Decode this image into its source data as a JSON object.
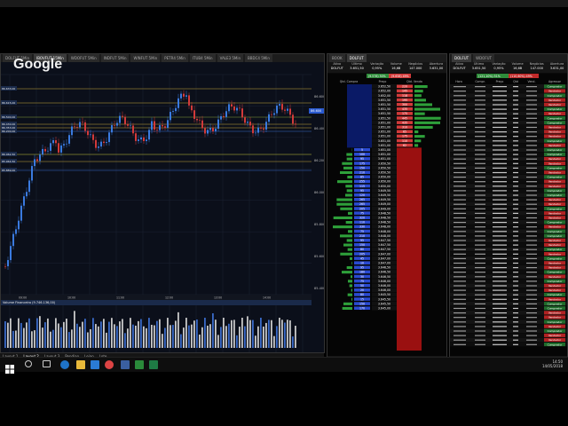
{
  "os": {
    "clock_time": "14:50",
    "clock_date": "14/05/2018"
  },
  "chart_window": {
    "tabs": [
      "DOLFUT 5Min",
      "IBOVFUT 15Min",
      "WDOFUT 5Min",
      "INDFUT 5Min",
      "WINFUT 5Min",
      "PETR4 5Min",
      "ITUB4 5Min",
      "VALE3 5Min",
      "BBDC4 5Min"
    ],
    "active_tab": "IBOVFUT 15Min",
    "info_line": "IBOVFUT 15Min | 86.595 86.828 86.515 86.605 -0,06% 5.963.674",
    "watermark": "Google",
    "volume_label": "Volume Financeiro (9.746.136,00)",
    "layouts": [
      "Layout 1",
      "Layout 2",
      "Layout 3",
      "Pendiao",
      "Leiao",
      "Lote"
    ],
    "active_layout": "Layout 2",
    "price_ticks": [
      "86.600",
      "86.400",
      "86.200",
      "86.000",
      "85.800",
      "85.600",
      "85.400"
    ],
    "time_ticks": [
      "09:00",
      "10:00",
      "11:00",
      "12:00",
      "13:00",
      "14:00"
    ],
    "level_labels": [
      "86.633,00",
      "86.615,00",
      "86.500,00",
      "86.430,00",
      "86.353,00",
      "86.200,00",
      "86.062,50",
      "85.964,50",
      "85.889,00"
    ]
  },
  "book_window": {
    "headers": [
      "Ativo",
      "Último",
      "Variação",
      "Volume",
      "Negócios",
      "Abertura"
    ],
    "values": [
      "DOLFUT",
      "3.651,50",
      "0,95%",
      "16,6B",
      "147.000",
      "3.631,00"
    ],
    "bid_total": "Qtd. Compra",
    "ask_total": "Qtd. Venda",
    "summary_left": "(9.576) 50%",
    "summary_right": "(9.658) 49%",
    "column_price": "Preço",
    "asks": [
      {
        "qty": "220",
        "price": "3.652,50"
      },
      {
        "qty": "145",
        "price": "3.652,00"
      },
      {
        "qty": "118",
        "price": "3.652,00"
      },
      {
        "qty": "195",
        "price": "3.651,50"
      },
      {
        "qty": "300",
        "price": "3.651,50"
      },
      {
        "qty": "435",
        "price": "3.651,50"
      },
      {
        "qty": "175",
        "price": "3.651,50"
      },
      {
        "qty": "445",
        "price": "3.651,50"
      },
      {
        "qty": "435",
        "price": "3.651,00"
      },
      {
        "qty": "310",
        "price": "3.651,00"
      },
      {
        "qty": "65",
        "price": "3.651,00"
      },
      {
        "qty": "175",
        "price": "3.651,00"
      },
      {
        "qty": "110",
        "price": "3.651,00"
      },
      {
        "qty": "62",
        "price": "3.651,00"
      }
    ],
    "bids": [
      {
        "qty": "5",
        "price": "3.651,00"
      },
      {
        "qty": "100",
        "price": "3.651,00"
      },
      {
        "qty": "95",
        "price": "3.651,00"
      },
      {
        "qty": "175",
        "price": "3.650,50"
      },
      {
        "qty": "150",
        "price": "3.650,50"
      },
      {
        "qty": "210",
        "price": "3.650,50"
      },
      {
        "qty": "85",
        "price": "3.650,00"
      },
      {
        "qty": "255",
        "price": "3.650,00"
      },
      {
        "qty": "115",
        "price": "3.650,00"
      },
      {
        "qty": "95",
        "price": "3.649,50"
      },
      {
        "qty": "120",
        "price": "3.649,50"
      },
      {
        "qty": "265",
        "price": "3.649,50"
      },
      {
        "qty": "265",
        "price": "3.649,00"
      },
      {
        "qty": "205",
        "price": "3.649,00"
      },
      {
        "qty": "75",
        "price": "3.648,50"
      },
      {
        "qty": "320",
        "price": "3.648,50"
      },
      {
        "qty": "110",
        "price": "3.648,50"
      },
      {
        "qty": "330",
        "price": "3.648,00"
      },
      {
        "qty": "75",
        "price": "3.648,00"
      },
      {
        "qty": "210",
        "price": "3.648,00"
      },
      {
        "qty": "95",
        "price": "3.647,50"
      },
      {
        "qty": "150",
        "price": "3.647,50"
      },
      {
        "qty": "80",
        "price": "3.647,50"
      },
      {
        "qty": "205",
        "price": "3.647,00"
      },
      {
        "qty": "45",
        "price": "3.647,00"
      },
      {
        "qty": "10",
        "price": "3.647,00"
      },
      {
        "qty": "95",
        "price": "3.646,50"
      },
      {
        "qty": "180",
        "price": "3.646,50"
      },
      {
        "qty": "30",
        "price": "3.646,50"
      },
      {
        "qty": "75",
        "price": "3.646,00"
      },
      {
        "qty": "50",
        "price": "3.646,00"
      },
      {
        "qty": "20",
        "price": "3.646,00"
      },
      {
        "qty": "80",
        "price": "3.645,50"
      },
      {
        "qty": "15",
        "price": "3.645,50"
      },
      {
        "qty": "150",
        "price": "3.645,50"
      },
      {
        "qty": "170",
        "price": "3.645,00"
      }
    ],
    "bottom_tabs": [
      "Book",
      "Book Agrupado",
      "Preço",
      "Times",
      "Volume"
    ],
    "active_bottom_tab": "Volume"
  },
  "times_window": {
    "headers": [
      "Ativo",
      "Último",
      "Variação",
      "Volume",
      "Negócios",
      "Abertura"
    ],
    "values": [
      "DOLFUT",
      "3.651,50",
      "0,95%",
      "16,6B",
      "147.000",
      "3.631,00"
    ],
    "summary_left": "(121,10%) 51%",
    "summary_right": "(110,60%) 49%",
    "columns": [
      "Hora",
      "Compr.",
      "Preço",
      "Qtd",
      "Vend.",
      "Agressor"
    ],
    "agressor_buy": "Comprador",
    "agressor_sell": "Vendedor",
    "bottom_tabs": [
      "Negócios",
      "Volume",
      "Book Digital",
      "Estatísticas",
      "Preços",
      "Feed"
    ],
    "active_bottom_tab": "Negócios",
    "colors": {
      "buy": "#2e8b3a",
      "sell": "#c12a2a",
      "buy_bg": "#1f6b2a",
      "sell_bg": "#b12222"
    }
  }
}
